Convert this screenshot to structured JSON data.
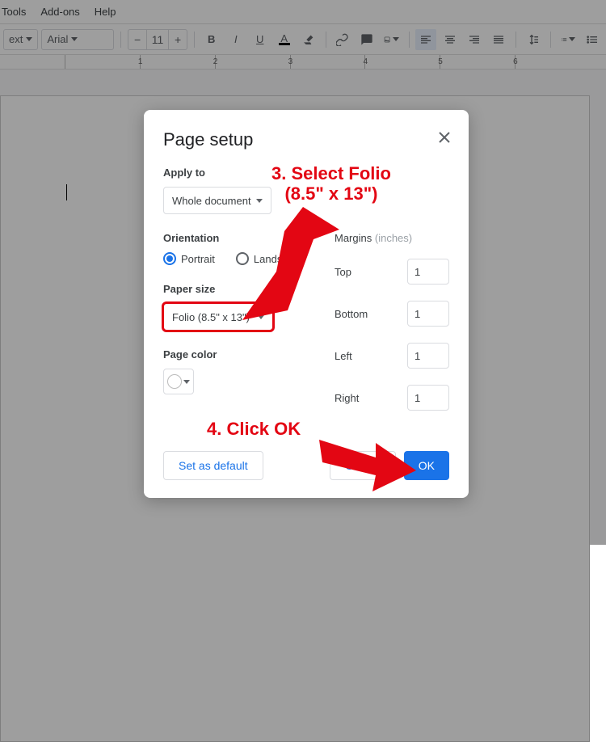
{
  "menubar": {
    "tools": "Tools",
    "addons": "Add-ons",
    "help": "Help"
  },
  "toolbar": {
    "style_label": "ext",
    "font_label": "Arial",
    "font_size": "11"
  },
  "ruler": {
    "ticks": [
      "",
      "1",
      "2",
      "3",
      "4",
      "5",
      "6"
    ]
  },
  "dialog": {
    "title": "Page setup",
    "apply_to_label": "Apply to",
    "apply_to_value": "Whole document",
    "orientation_label": "Orientation",
    "portrait": "Portrait",
    "landscape": "Landscape",
    "paper_size_label": "Paper size",
    "paper_size_value": "Folio (8.5\" x 13\")",
    "page_color_label": "Page color",
    "margins_label": "Margins",
    "margins_unit": "(inches)",
    "top": "Top",
    "bottom": "Bottom",
    "left": "Left",
    "right": "Right",
    "margin_values": {
      "top": "1",
      "bottom": "1",
      "left": "1",
      "right": "1"
    },
    "set_default": "Set as default",
    "cancel": "Cancel",
    "ok": "OK"
  },
  "annotations": {
    "step3_line1": "3. Select Folio",
    "step3_line2": "(8.5\" x 13\")",
    "step4": "4. Click OK"
  }
}
